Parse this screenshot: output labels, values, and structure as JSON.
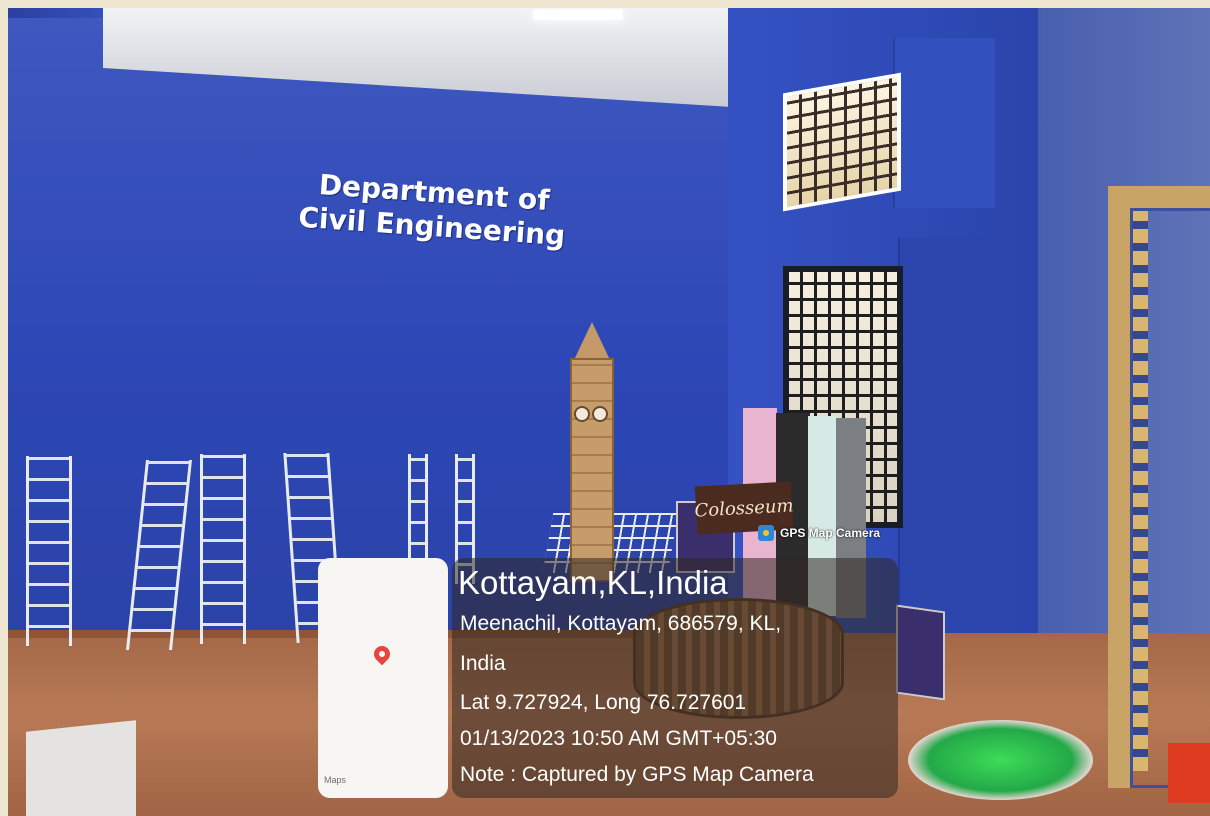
{
  "sign": {
    "line1": "Department of",
    "line2": "Civil Engineering"
  },
  "model_label": {
    "text": "Colosseum"
  },
  "gps_overlay": {
    "app_label": "GPS Map Camera",
    "app_icon": "gps-map-camera-icon",
    "title": "Kottayam,KL,India",
    "address_line1": "Meenachil, Kottayam, 686579, KL,",
    "address_line2": "India",
    "coordinates": "Lat 9.727924, Long 76.727601",
    "datetime": "01/13/2023 10:50 AM GMT+05:30",
    "note": "Note : Captured by GPS Map Camera",
    "map_credit": "Maps",
    "map_icon": "location-pin-icon"
  },
  "colors": {
    "wall_blue": "#2f47b8",
    "floor_brown": "#b87a56",
    "pin_red": "#e8453c"
  }
}
